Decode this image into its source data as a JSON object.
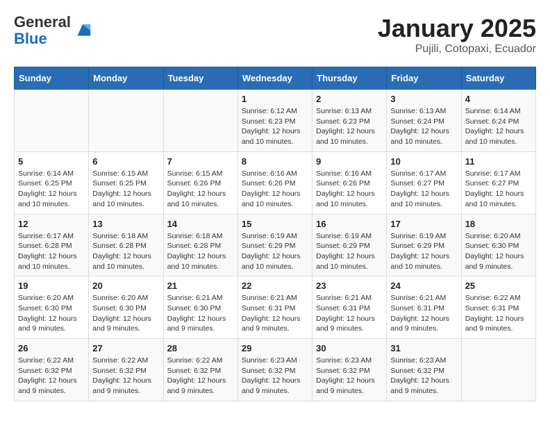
{
  "header": {
    "logo_general": "General",
    "logo_blue": "Blue",
    "title": "January 2025",
    "subtitle": "Pujili, Cotopaxi, Ecuador"
  },
  "weekdays": [
    "Sunday",
    "Monday",
    "Tuesday",
    "Wednesday",
    "Thursday",
    "Friday",
    "Saturday"
  ],
  "weeks": [
    [
      {
        "day": "",
        "info": ""
      },
      {
        "day": "",
        "info": ""
      },
      {
        "day": "",
        "info": ""
      },
      {
        "day": "1",
        "info": "Sunrise: 6:12 AM\nSunset: 6:23 PM\nDaylight: 12 hours\nand 10 minutes."
      },
      {
        "day": "2",
        "info": "Sunrise: 6:13 AM\nSunset: 6:23 PM\nDaylight: 12 hours\nand 10 minutes."
      },
      {
        "day": "3",
        "info": "Sunrise: 6:13 AM\nSunset: 6:24 PM\nDaylight: 12 hours\nand 10 minutes."
      },
      {
        "day": "4",
        "info": "Sunrise: 6:14 AM\nSunset: 6:24 PM\nDaylight: 12 hours\nand 10 minutes."
      }
    ],
    [
      {
        "day": "5",
        "info": "Sunrise: 6:14 AM\nSunset: 6:25 PM\nDaylight: 12 hours\nand 10 minutes."
      },
      {
        "day": "6",
        "info": "Sunrise: 6:15 AM\nSunset: 6:25 PM\nDaylight: 12 hours\nand 10 minutes."
      },
      {
        "day": "7",
        "info": "Sunrise: 6:15 AM\nSunset: 6:26 PM\nDaylight: 12 hours\nand 10 minutes."
      },
      {
        "day": "8",
        "info": "Sunrise: 6:16 AM\nSunset: 6:26 PM\nDaylight: 12 hours\nand 10 minutes."
      },
      {
        "day": "9",
        "info": "Sunrise: 6:16 AM\nSunset: 6:26 PM\nDaylight: 12 hours\nand 10 minutes."
      },
      {
        "day": "10",
        "info": "Sunrise: 6:17 AM\nSunset: 6:27 PM\nDaylight: 12 hours\nand 10 minutes."
      },
      {
        "day": "11",
        "info": "Sunrise: 6:17 AM\nSunset: 6:27 PM\nDaylight: 12 hours\nand 10 minutes."
      }
    ],
    [
      {
        "day": "12",
        "info": "Sunrise: 6:17 AM\nSunset: 6:28 PM\nDaylight: 12 hours\nand 10 minutes."
      },
      {
        "day": "13",
        "info": "Sunrise: 6:18 AM\nSunset: 6:28 PM\nDaylight: 12 hours\nand 10 minutes."
      },
      {
        "day": "14",
        "info": "Sunrise: 6:18 AM\nSunset: 6:28 PM\nDaylight: 12 hours\nand 10 minutes."
      },
      {
        "day": "15",
        "info": "Sunrise: 6:19 AM\nSunset: 6:29 PM\nDaylight: 12 hours\nand 10 minutes."
      },
      {
        "day": "16",
        "info": "Sunrise: 6:19 AM\nSunset: 6:29 PM\nDaylight: 12 hours\nand 10 minutes."
      },
      {
        "day": "17",
        "info": "Sunrise: 6:19 AM\nSunset: 6:29 PM\nDaylight: 12 hours\nand 10 minutes."
      },
      {
        "day": "18",
        "info": "Sunrise: 6:20 AM\nSunset: 6:30 PM\nDaylight: 12 hours\nand 9 minutes."
      }
    ],
    [
      {
        "day": "19",
        "info": "Sunrise: 6:20 AM\nSunset: 6:30 PM\nDaylight: 12 hours\nand 9 minutes."
      },
      {
        "day": "20",
        "info": "Sunrise: 6:20 AM\nSunset: 6:30 PM\nDaylight: 12 hours\nand 9 minutes."
      },
      {
        "day": "21",
        "info": "Sunrise: 6:21 AM\nSunset: 6:30 PM\nDaylight: 12 hours\nand 9 minutes."
      },
      {
        "day": "22",
        "info": "Sunrise: 6:21 AM\nSunset: 6:31 PM\nDaylight: 12 hours\nand 9 minutes."
      },
      {
        "day": "23",
        "info": "Sunrise: 6:21 AM\nSunset: 6:31 PM\nDaylight: 12 hours\nand 9 minutes."
      },
      {
        "day": "24",
        "info": "Sunrise: 6:21 AM\nSunset: 6:31 PM\nDaylight: 12 hours\nand 9 minutes."
      },
      {
        "day": "25",
        "info": "Sunrise: 6:22 AM\nSunset: 6:31 PM\nDaylight: 12 hours\nand 9 minutes."
      }
    ],
    [
      {
        "day": "26",
        "info": "Sunrise: 6:22 AM\nSunset: 6:32 PM\nDaylight: 12 hours\nand 9 minutes."
      },
      {
        "day": "27",
        "info": "Sunrise: 6:22 AM\nSunset: 6:32 PM\nDaylight: 12 hours\nand 9 minutes."
      },
      {
        "day": "28",
        "info": "Sunrise: 6:22 AM\nSunset: 6:32 PM\nDaylight: 12 hours\nand 9 minutes."
      },
      {
        "day": "29",
        "info": "Sunrise: 6:23 AM\nSunset: 6:32 PM\nDaylight: 12 hours\nand 9 minutes."
      },
      {
        "day": "30",
        "info": "Sunrise: 6:23 AM\nSunset: 6:32 PM\nDaylight: 12 hours\nand 9 minutes."
      },
      {
        "day": "31",
        "info": "Sunrise: 6:23 AM\nSunset: 6:32 PM\nDaylight: 12 hours\nand 9 minutes."
      },
      {
        "day": "",
        "info": ""
      }
    ]
  ]
}
